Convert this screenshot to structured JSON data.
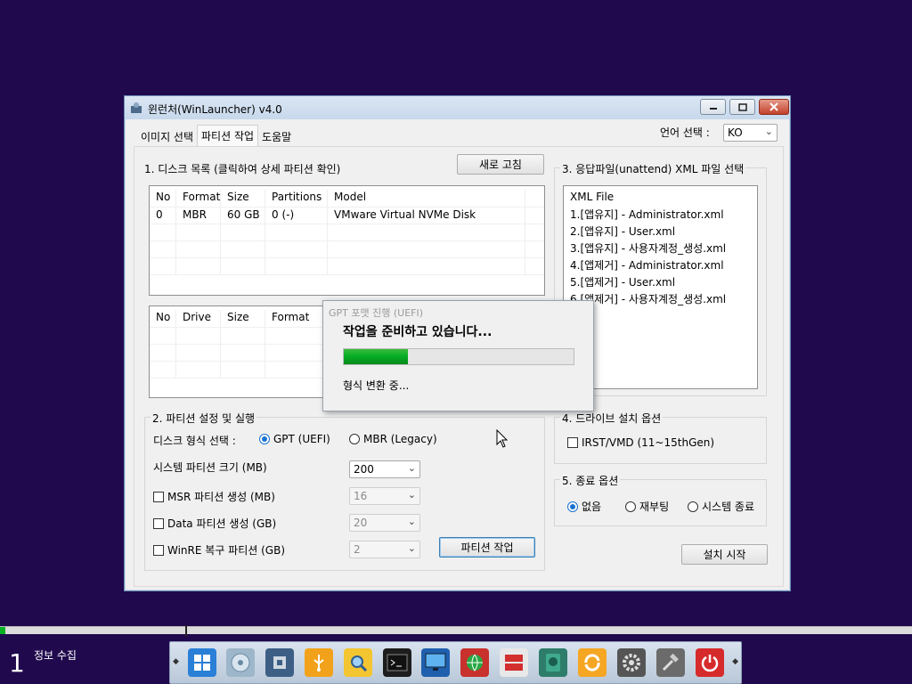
{
  "window": {
    "title": "윈런처(WinLauncher) v4.0"
  },
  "tabs": [
    "이미지 선택",
    "파티션 작업",
    "도움말"
  ],
  "language": {
    "label": "언어 선택 :",
    "value": "KO"
  },
  "disk_section": {
    "title": "1. 디스크 목록 (클릭하여 상세 파티션 확인)",
    "refresh_label": "새로 고침",
    "columns": [
      "No",
      "Format",
      "Size",
      "Partitions",
      "Model"
    ],
    "rows": [
      [
        "0",
        "MBR",
        "60 GB",
        "0 (-)",
        "VMware Virtual NVMe Disk"
      ]
    ]
  },
  "drive_list": {
    "columns": [
      "No",
      "Drive",
      "Size",
      "Format"
    ]
  },
  "xml_section": {
    "title": "3. 응답파일(unattend) XML 파일 선택",
    "header": "XML File",
    "items": [
      "1.[앱유지] - Administrator.xml",
      "2.[앱유지] - User.xml",
      "3.[앱유지] - 사용자계정_생성.xml",
      "4.[앱제거] - Administrator.xml",
      "5.[앱제거] - User.xml",
      "6.[앱제거] - 사용자계정_생성.xml"
    ]
  },
  "partition_section": {
    "title": "2. 파티션 설정 및 실행",
    "disk_type_label": "디스크 형식 선택 :",
    "gpt_label": "GPT (UEFI)",
    "mbr_label": "MBR (Legacy)",
    "system_size_label": "시스템 파티션 크기 (MB)",
    "system_size_value": "200",
    "msr_label": "MSR 파티션 생성 (MB)",
    "msr_value": "16",
    "data_label": "Data 파티션 생성 (GB)",
    "data_value": "20",
    "winre_label": "WinRE 복구 파티션 (GB)",
    "winre_value": "2",
    "run_label": "파티션 작업"
  },
  "drive_options": {
    "title": "4. 드라이브 설치 옵션",
    "irst_label": "IRST/VMD (11~15thGen)"
  },
  "exit_options": {
    "title": "5. 종료 옵션",
    "none_label": "없음",
    "reboot_label": "재부팅",
    "shutdown_label": "시스템 종료"
  },
  "install_label": "설치 시작",
  "progress_dialog": {
    "title": "GPT 포맷 진행 (UEFI)",
    "heading": "작업을 준비하고 있습니다...",
    "progress": 0.28,
    "status": "형식 변환 중..."
  },
  "taskbar": {
    "desk_number": "1",
    "desk_label": "정보 수집",
    "strip_progress": 0.006
  },
  "dock_icons": [
    "windows-install-icon",
    "disk-image-icon",
    "hardware-icon",
    "usb-icon",
    "search-folder-icon",
    "terminal-icon",
    "monitor-icon",
    "network-icon",
    "partition-icon",
    "hdd-icon",
    "sync-icon",
    "settings-icon",
    "tools-icon",
    "power-icon"
  ],
  "colors": {
    "desktop": "#21094e",
    "progress_green": "#06b025",
    "accent_blue": "#1b73d0"
  }
}
